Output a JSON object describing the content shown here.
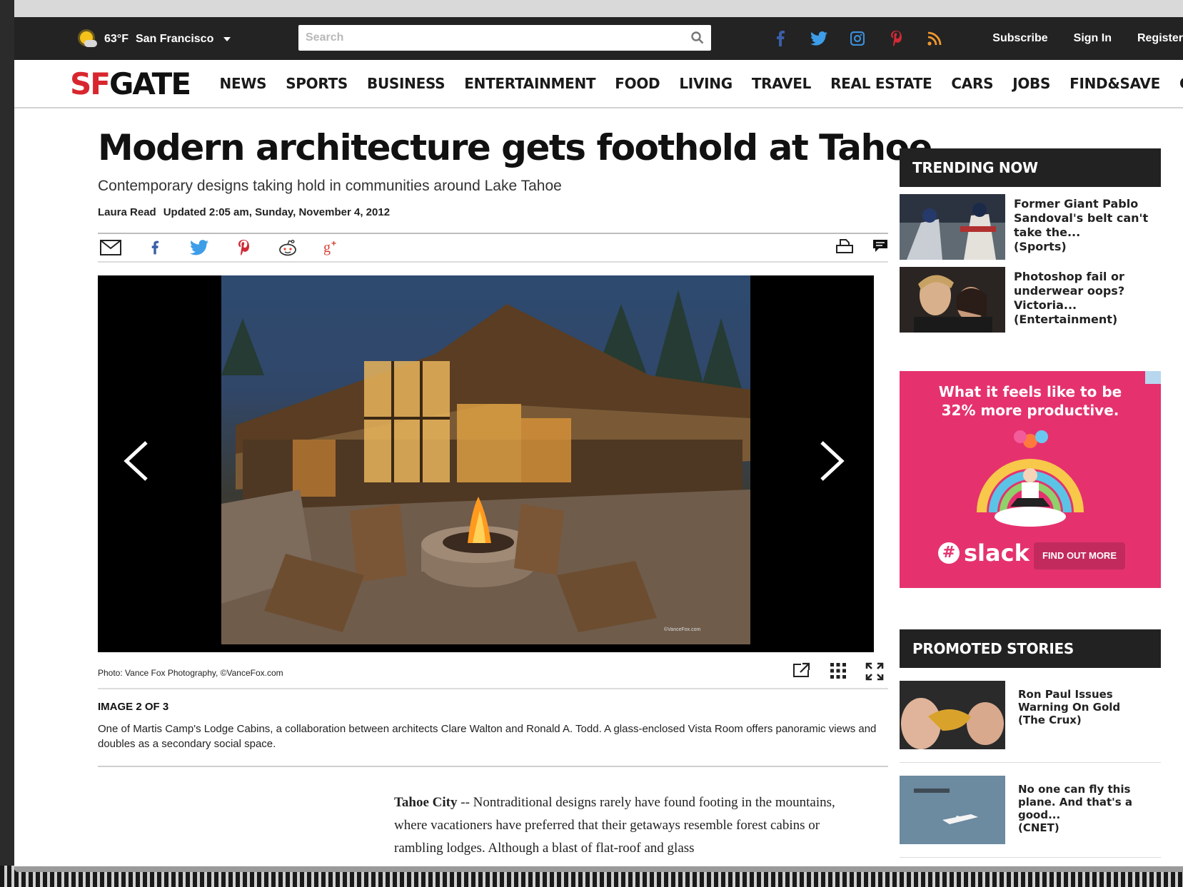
{
  "weather": {
    "temp": "63°F",
    "city": "San Francisco"
  },
  "search": {
    "placeholder": "Search"
  },
  "account": {
    "subscribe": "Subscribe",
    "sign_in": "Sign In",
    "register": "Register"
  },
  "brand": {
    "logo_sf": "SF",
    "logo_gate": "GATE",
    "red": "#d8262e"
  },
  "nav": [
    "NEWS",
    "SPORTS",
    "BUSINESS",
    "ENTERTAINMENT",
    "FOOD",
    "LIVING",
    "TRAVEL",
    "REAL ESTATE",
    "CARS",
    "JOBS",
    "FIND&SAVE",
    "CHRONICLE"
  ],
  "article": {
    "headline": "Modern architecture gets foothold at Tahoe",
    "dek": "Contemporary designs taking hold in communities around Lake Tahoe",
    "author": "Laura Read",
    "updated": "Updated 2:05 am, Sunday, November 4, 2012",
    "photo_credit": "Photo: Vance Fox Photography, ©VanceFox.com",
    "image_count": "IMAGE 2 OF 3",
    "caption": "One of Martis Camp's Lodge Cabins, a collaboration between architects Clare Walton and Ronald A. Todd. A glass-enclosed Vista Room offers panoramic views and doubles as a secondary social space.",
    "watermark": "©VanceFox.com",
    "dateline": "Tahoe City",
    "body": " -- Nontraditional designs rarely have found footing in the mountains, where vacationers have preferred that their getaways resemble forest cabins or rambling lodges. Although a blast of flat-roof and glass"
  },
  "trending": {
    "heading": "TRENDING NOW",
    "items": [
      {
        "title": "Former Giant Pablo Sandoval's belt can't take the...",
        "section": "(Sports)"
      },
      {
        "title": "Photoshop fail or underwear oops? Victoria...",
        "section": "(Entertainment)"
      }
    ]
  },
  "ad": {
    "headline_1": "What it feels like to be",
    "headline_2": "32% more productive.",
    "brand": "slack",
    "cta": "FIND OUT MORE"
  },
  "promoted": {
    "heading": "PROMOTED STORIES",
    "items": [
      {
        "title": "Ron Paul Issues Warning On Gold",
        "source": "(The Crux)"
      },
      {
        "title": "No one can fly this plane. And that's a good...",
        "source": "(CNET)"
      }
    ]
  }
}
